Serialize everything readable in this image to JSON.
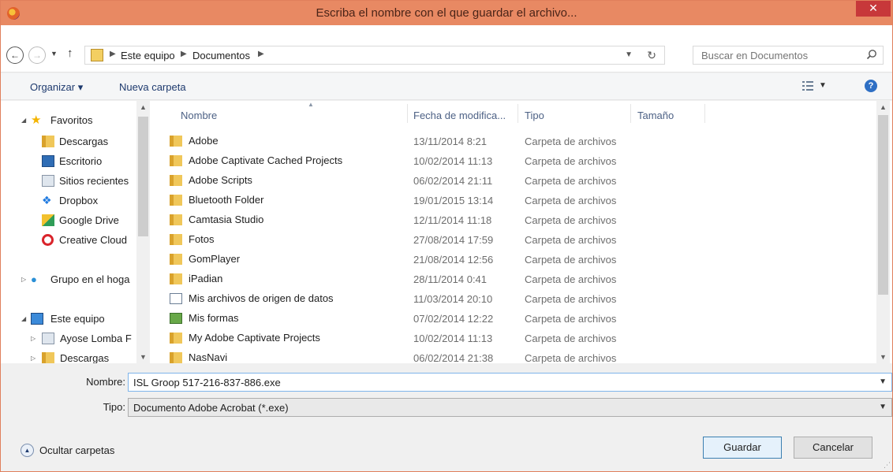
{
  "window": {
    "title": "Escriba el nombre con el que guardar el archivo...",
    "close_glyph": "✕"
  },
  "address": {
    "crumbs": [
      "Este equipo",
      "Documentos"
    ],
    "search_placeholder": "Buscar en Documentos"
  },
  "toolbar": {
    "organize": "Organizar ▾",
    "new_folder": "Nueva carpeta"
  },
  "nav": {
    "favorites": "Favoritos",
    "items": [
      "Descargas",
      "Escritorio",
      "Sitios recientes",
      "Dropbox",
      "Google Drive",
      "Creative Cloud"
    ],
    "homegroup": "Grupo en el hoga",
    "this_pc": "Este equipo",
    "pc_items": [
      "Ayose Lomba F",
      "Descargas"
    ]
  },
  "columns": {
    "name": "Nombre",
    "date": "Fecha de modifica...",
    "type": "Tipo",
    "size": "Tamaño"
  },
  "files": [
    {
      "name": "Adobe",
      "date": "13/11/2014 8:21",
      "type": "Carpeta de archivos",
      "icon": "folder"
    },
    {
      "name": "Adobe Captivate Cached Projects",
      "date": "10/02/2014 11:13",
      "type": "Carpeta de archivos",
      "icon": "folder"
    },
    {
      "name": "Adobe Scripts",
      "date": "06/02/2014 21:11",
      "type": "Carpeta de archivos",
      "icon": "folder"
    },
    {
      "name": "Bluetooth Folder",
      "date": "19/01/2015 13:14",
      "type": "Carpeta de archivos",
      "icon": "folder"
    },
    {
      "name": "Camtasia Studio",
      "date": "12/11/2014 11:18",
      "type": "Carpeta de archivos",
      "icon": "folder"
    },
    {
      "name": "Fotos",
      "date": "27/08/2014 17:59",
      "type": "Carpeta de archivos",
      "icon": "folder"
    },
    {
      "name": "GomPlayer",
      "date": "21/08/2014 12:56",
      "type": "Carpeta de archivos",
      "icon": "folder"
    },
    {
      "name": "iPadian",
      "date": "28/11/2014 0:41",
      "type": "Carpeta de archivos",
      "icon": "folder"
    },
    {
      "name": "Mis archivos de origen de datos",
      "date": "11/03/2014 20:10",
      "type": "Carpeta de archivos",
      "icon": "datasource"
    },
    {
      "name": "Mis formas",
      "date": "07/02/2014 12:22",
      "type": "Carpeta de archivos",
      "icon": "forms"
    },
    {
      "name": "My Adobe Captivate Projects",
      "date": "10/02/2014 11:13",
      "type": "Carpeta de archivos",
      "icon": "folder"
    },
    {
      "name": "NasNavi",
      "date": "06/02/2014 21:38",
      "type": "Carpeta de archivos",
      "icon": "folder"
    }
  ],
  "form": {
    "name_label": "Nombre:",
    "name_value": "ISL Groop 517-216-837-886.exe",
    "type_label": "Tipo:",
    "type_value": "Documento Adobe Acrobat (*.exe)"
  },
  "footer": {
    "hide_folders": "Ocultar carpetas",
    "save": "Guardar",
    "cancel": "Cancelar"
  },
  "colors": {
    "titlebar": "#e88963",
    "close": "#c7383a",
    "header_text": "#4d6185",
    "folder": "#f0c75a"
  }
}
